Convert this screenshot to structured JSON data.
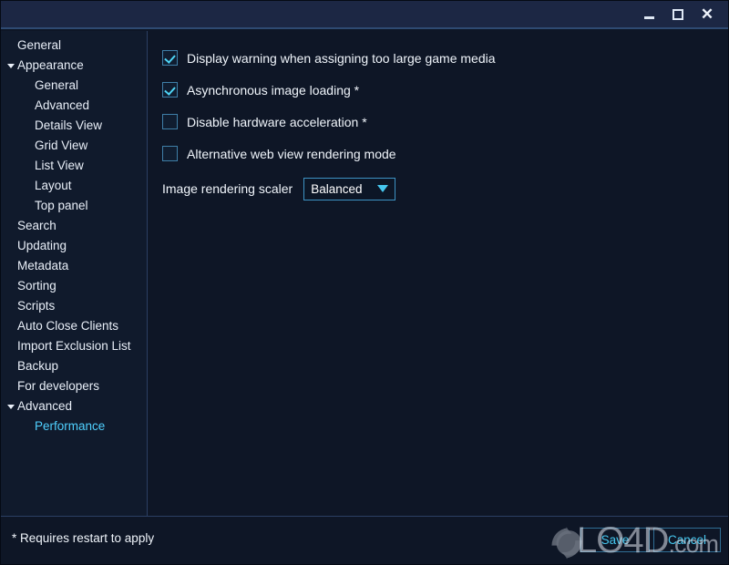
{
  "window": {
    "controls": [
      {
        "name": "minimize",
        "label": "–"
      },
      {
        "name": "maximize",
        "label": "□"
      },
      {
        "name": "close",
        "label": "✕"
      }
    ]
  },
  "sidebar": {
    "items": [
      {
        "label": "General",
        "level": 0,
        "arrow": false,
        "selected": false
      },
      {
        "label": "Appearance",
        "level": 0,
        "arrow": true,
        "selected": false
      },
      {
        "label": "General",
        "level": 1,
        "arrow": false,
        "selected": false
      },
      {
        "label": "Advanced",
        "level": 1,
        "arrow": false,
        "selected": false
      },
      {
        "label": "Details View",
        "level": 1,
        "arrow": false,
        "selected": false
      },
      {
        "label": "Grid View",
        "level": 1,
        "arrow": false,
        "selected": false
      },
      {
        "label": "List View",
        "level": 1,
        "arrow": false,
        "selected": false
      },
      {
        "label": "Layout",
        "level": 1,
        "arrow": false,
        "selected": false
      },
      {
        "label": "Top panel",
        "level": 1,
        "arrow": false,
        "selected": false
      },
      {
        "label": "Search",
        "level": 0,
        "arrow": false,
        "selected": false
      },
      {
        "label": "Updating",
        "level": 0,
        "arrow": false,
        "selected": false
      },
      {
        "label": "Metadata",
        "level": 0,
        "arrow": false,
        "selected": false
      },
      {
        "label": "Sorting",
        "level": 0,
        "arrow": false,
        "selected": false
      },
      {
        "label": "Scripts",
        "level": 0,
        "arrow": false,
        "selected": false
      },
      {
        "label": "Auto Close Clients",
        "level": 0,
        "arrow": false,
        "selected": false
      },
      {
        "label": "Import Exclusion List",
        "level": 0,
        "arrow": false,
        "selected": false
      },
      {
        "label": "Backup",
        "level": 0,
        "arrow": false,
        "selected": false
      },
      {
        "label": "For developers",
        "level": 0,
        "arrow": false,
        "selected": false
      },
      {
        "label": "Advanced",
        "level": 0,
        "arrow": true,
        "selected": false
      },
      {
        "label": "Performance",
        "level": 1,
        "arrow": false,
        "selected": true
      }
    ]
  },
  "main": {
    "checkboxes": [
      {
        "label": "Display warning when assigning too large game media",
        "checked": true
      },
      {
        "label": "Asynchronous image loading *",
        "checked": true
      },
      {
        "label": "Disable hardware acceleration *",
        "checked": false
      },
      {
        "label": "Alternative web view rendering mode",
        "checked": false
      }
    ],
    "scaler": {
      "label": "Image rendering scaler",
      "value": "Balanced",
      "options": [
        "Balanced"
      ]
    }
  },
  "footer": {
    "note": "* Requires restart to apply",
    "save_label": "Save",
    "cancel_label": "Cancel"
  },
  "watermark": {
    "text": "LO4D",
    "suffix": ".com"
  },
  "colors": {
    "titlebar": "#1c2744",
    "background": "#0e1626",
    "sidebar": "#101a2c",
    "accent": "#46c8f0",
    "selected_text": "#4fd0ff",
    "text": "#f0f5fb",
    "divider": "#2b3f63"
  }
}
